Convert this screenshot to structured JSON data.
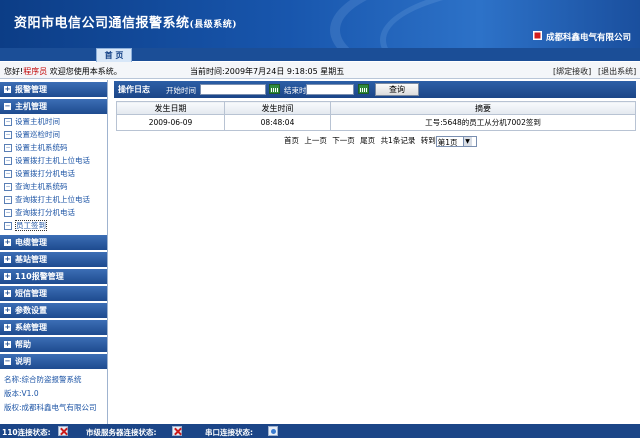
{
  "header": {
    "title": "资阳市电信公司通信报警系统",
    "title_sub": "(县级系统)",
    "company": "成都科鑫电气有限公司",
    "tab_home": "首  页"
  },
  "info": {
    "hello": "您好!",
    "role": "程序员",
    "welcome": "欢迎您使用本系统。",
    "current_time": "当前时间:2009年7月24日 9:18:05 星期五",
    "bind_link": "[绑定接收]",
    "exit_link": "[退出系统]"
  },
  "sidebar": {
    "menus": [
      {
        "label": "报警管理",
        "expanded": false
      },
      {
        "label": "主机管理",
        "expanded": true
      },
      {
        "label": "电缆管理",
        "expanded": false
      },
      {
        "label": "基站管理",
        "expanded": false
      },
      {
        "label": "110报警管理",
        "expanded": false
      },
      {
        "label": "短信管理",
        "expanded": false
      },
      {
        "label": "参数设置",
        "expanded": false
      },
      {
        "label": "系统管理",
        "expanded": false
      },
      {
        "label": "帮助",
        "expanded": false
      },
      {
        "label": "说明",
        "expanded": true
      }
    ],
    "host_items": [
      "设置主机时间",
      "设置巡检时间",
      "设置主机系统码",
      "设置拨打主机上位电话",
      "设置拨打分机电话",
      "查询主机系统码",
      "查询拨打主机上位电话",
      "查询拨打分机电话",
      "员工签到"
    ],
    "selected_item": "员工签到",
    "about": {
      "name": "名称:综合防盗报警系统",
      "version": "版本:V1.0",
      "copyright": "版权:成都科鑫电气有限公司"
    }
  },
  "toolbar": {
    "op_log": "操作日志",
    "start_label": "开始时间",
    "start_value": "",
    "end_label": "结束时间",
    "end_value": "",
    "query_button": "查询"
  },
  "table": {
    "columns": [
      "发生日期",
      "发生时间",
      "摘要"
    ],
    "rows": [
      [
        "2009-06-09",
        "08:48:04",
        "工号:5648的员工从分机7002签到"
      ]
    ]
  },
  "pager": {
    "first": "首页",
    "prev": "上一页",
    "next": "下一页",
    "last": "尾页",
    "total": "共1条记录",
    "goto": "转到",
    "page_value": "第1页"
  },
  "status": {
    "link110": "110连接状态:",
    "server": "市级服务器连接状态:",
    "serial": "串口连接状态:"
  },
  "colors": {
    "header_blue": "#1856ad",
    "menu_blue": "#1e4b8f",
    "link_blue": "#1f56a6",
    "role_red": "#c00000",
    "status_error": "#cc1b1b"
  }
}
